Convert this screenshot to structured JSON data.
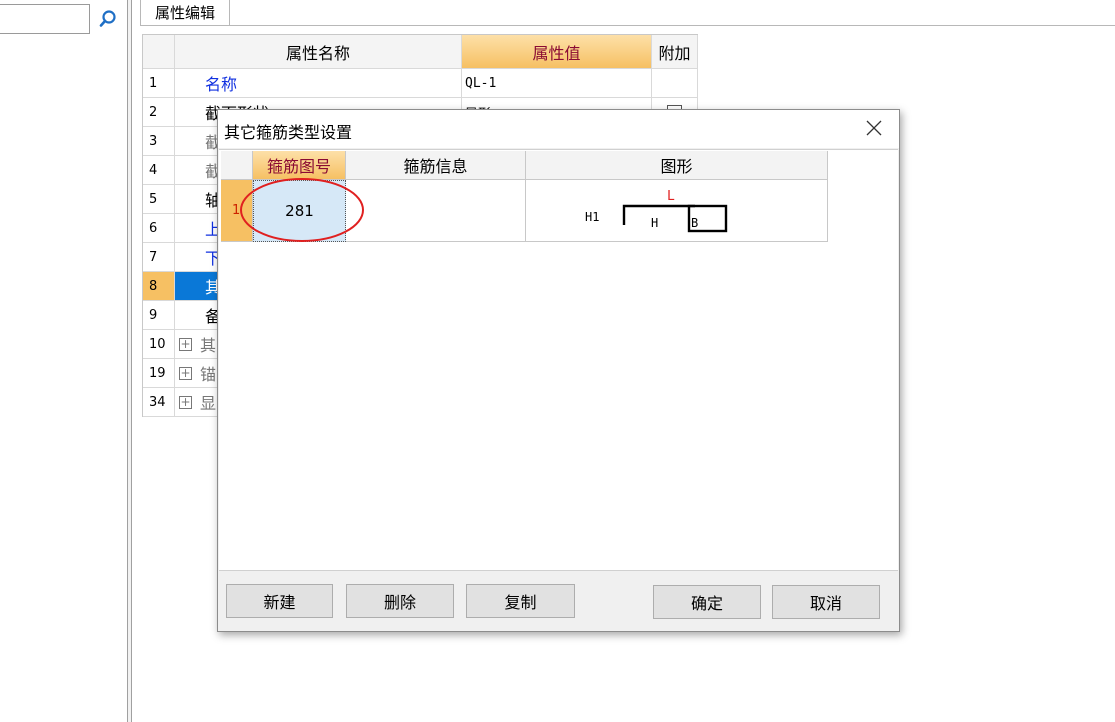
{
  "search": {
    "value": "",
    "placeholder": ""
  },
  "tab": {
    "label": "属性编辑"
  },
  "property_grid": {
    "headers": {
      "name": "属性名称",
      "value": "属性值",
      "extra": "附加"
    },
    "rows": [
      {
        "index": "1",
        "name": "名称",
        "value": "QL-1",
        "style": "blue",
        "expand": false,
        "checkbox": false
      },
      {
        "index": "2",
        "name": "截面形状",
        "value": "异形",
        "style": "normal",
        "expand": false,
        "checkbox": true
      },
      {
        "index": "3",
        "name": "截",
        "value": "",
        "style": "grey",
        "expand": false,
        "checkbox": false
      },
      {
        "index": "4",
        "name": "截",
        "value": "",
        "style": "grey",
        "expand": false,
        "checkbox": false
      },
      {
        "index": "5",
        "name": "轴",
        "value": "",
        "style": "normal",
        "expand": false,
        "checkbox": false
      },
      {
        "index": "6",
        "name": "上",
        "value": "",
        "style": "blue",
        "expand": false,
        "checkbox": false
      },
      {
        "index": "7",
        "name": "下",
        "value": "",
        "style": "blue",
        "expand": false,
        "checkbox": false
      },
      {
        "index": "8",
        "name": "其",
        "value": "",
        "style": "selected",
        "expand": false,
        "checkbox": false
      },
      {
        "index": "9",
        "name": "备",
        "value": "",
        "style": "normal",
        "expand": false,
        "checkbox": false
      },
      {
        "index": "10",
        "name": "其",
        "value": "",
        "style": "grey",
        "expand": true,
        "checkbox": false
      },
      {
        "index": "19",
        "name": "锚",
        "value": "",
        "style": "grey",
        "expand": true,
        "checkbox": false
      },
      {
        "index": "34",
        "name": "显",
        "value": "",
        "style": "grey",
        "expand": true,
        "checkbox": false
      }
    ]
  },
  "dialog": {
    "title": "其它箍筋类型设置",
    "table": {
      "headers": [
        "箍筋图号",
        "箍筋信息",
        "图形"
      ],
      "rows": [
        {
          "index": "1",
          "number": "281",
          "info": "",
          "shape_labels": {
            "top": "L",
            "left": "H1",
            "middle": "H",
            "right": "B"
          }
        }
      ]
    },
    "buttons": {
      "new": "新建",
      "delete": "删除",
      "copy": "复制",
      "ok": "确定",
      "cancel": "取消"
    }
  },
  "colors": {
    "header_highlight": "#f6c063",
    "selected_row": "#0a78d7",
    "link_blue": "#1030e0",
    "annotation_red": "#e02020",
    "selected_cell": "#d6e8f7"
  }
}
